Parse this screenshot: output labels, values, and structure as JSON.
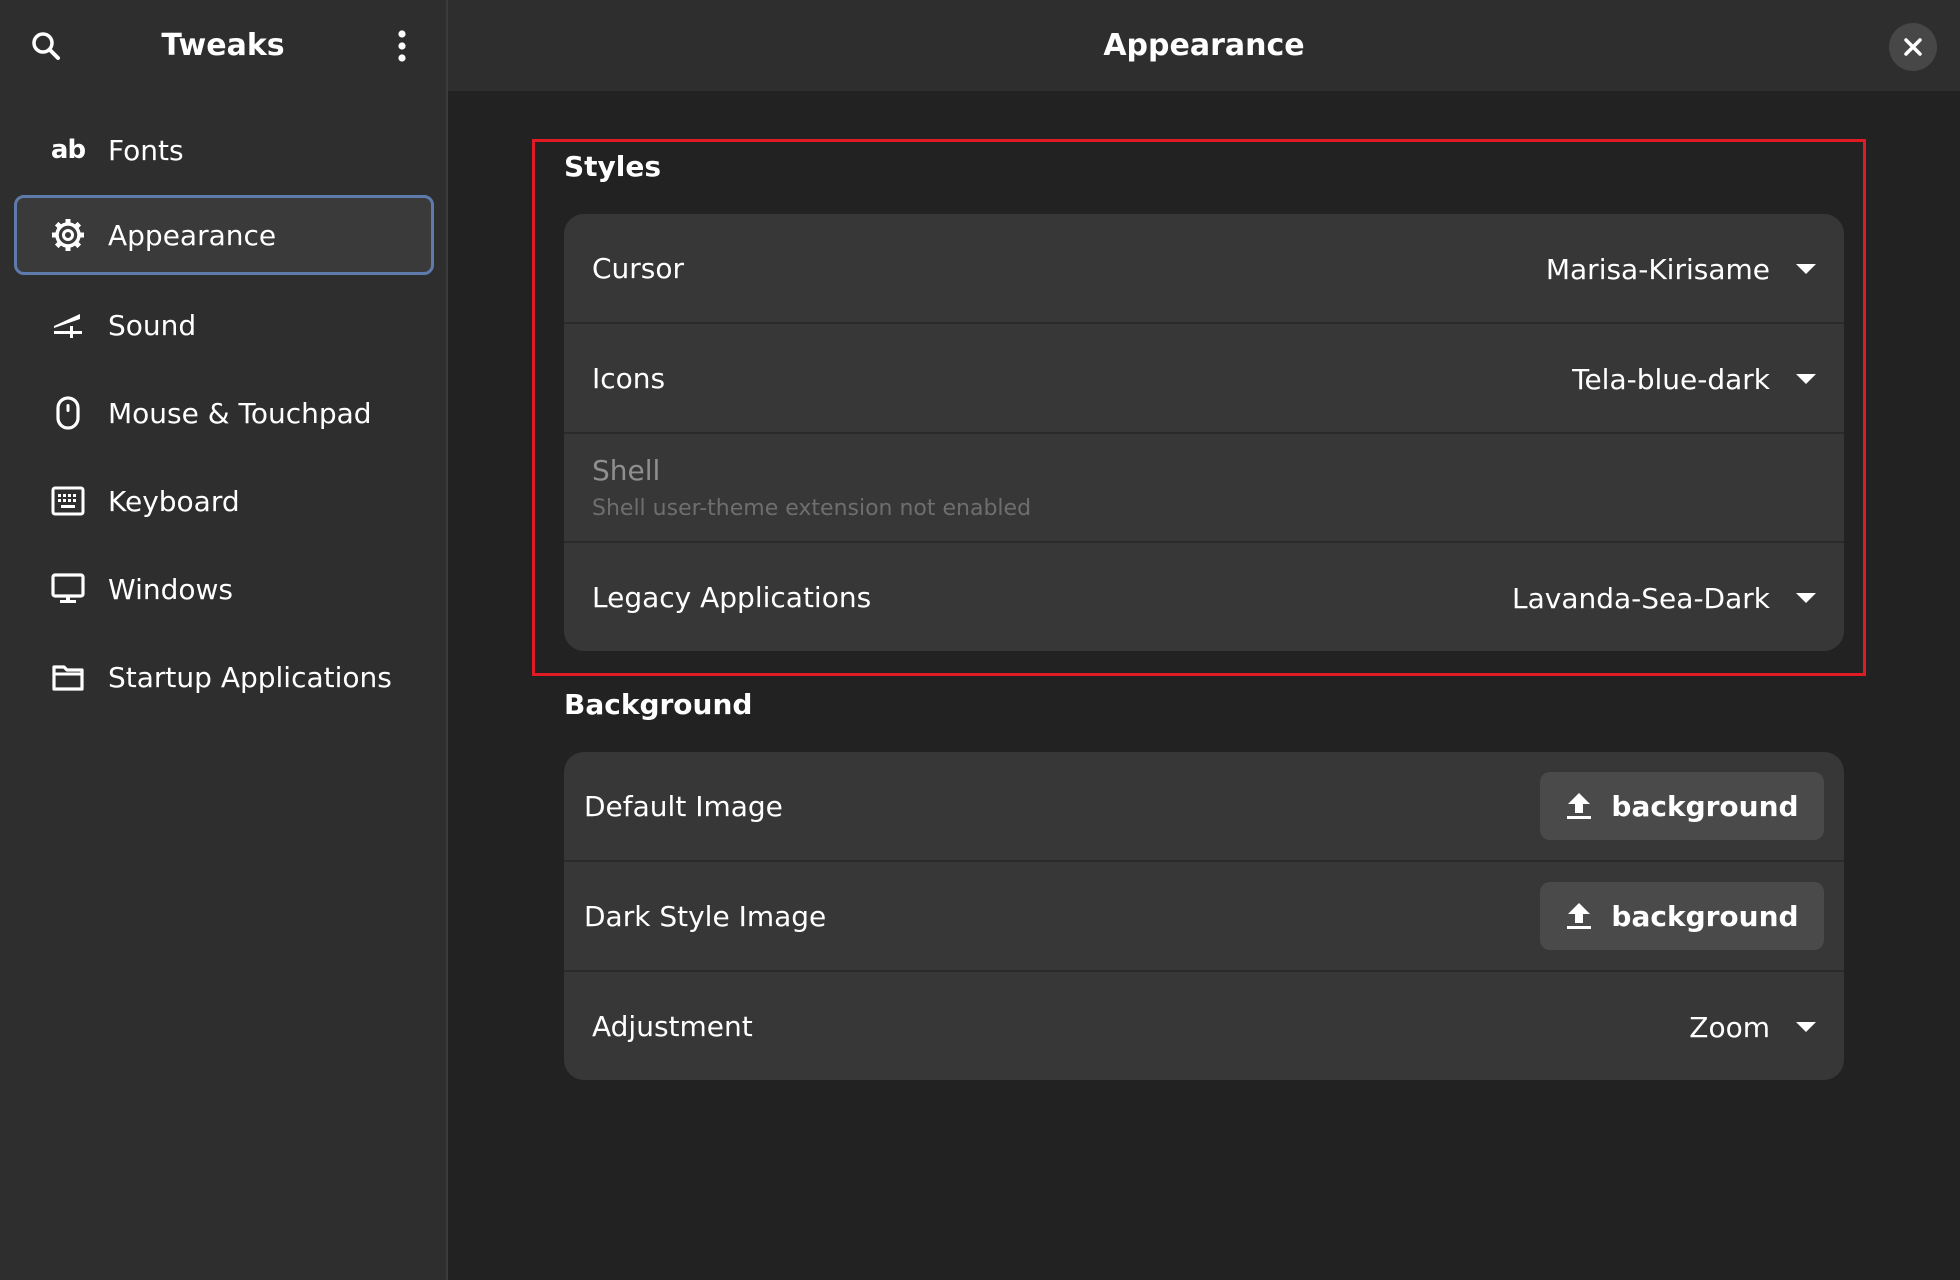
{
  "sidebar": {
    "title": "Tweaks",
    "items": [
      {
        "label": "Fonts",
        "icon": "fonts-icon"
      },
      {
        "label": "Appearance",
        "icon": "gear-icon",
        "active": true
      },
      {
        "label": "Sound",
        "icon": "sound-icon"
      },
      {
        "label": "Mouse & Touchpad",
        "icon": "mouse-icon"
      },
      {
        "label": "Keyboard",
        "icon": "keyboard-icon"
      },
      {
        "label": "Windows",
        "icon": "monitor-icon"
      },
      {
        "label": "Startup Applications",
        "icon": "folder-icon"
      }
    ]
  },
  "header": {
    "title": "Appearance"
  },
  "styles": {
    "title": "Styles",
    "cursor": {
      "label": "Cursor",
      "value": "Marisa-Kirisame"
    },
    "icons": {
      "label": "Icons",
      "value": "Tela-blue-dark"
    },
    "shell": {
      "label": "Shell",
      "subtitle": "Shell user-theme extension not enabled"
    },
    "legacy": {
      "label": "Legacy Applications",
      "value": "Lavanda-Sea-Dark"
    }
  },
  "background": {
    "title": "Background",
    "default_image": {
      "label": "Default Image",
      "button": "background"
    },
    "dark_image": {
      "label": "Dark Style Image",
      "button": "background"
    },
    "adjustment": {
      "label": "Adjustment",
      "value": "Zoom"
    }
  },
  "colors": {
    "accent_highlight": "#e01b24",
    "active_border": "#5f7bac"
  }
}
